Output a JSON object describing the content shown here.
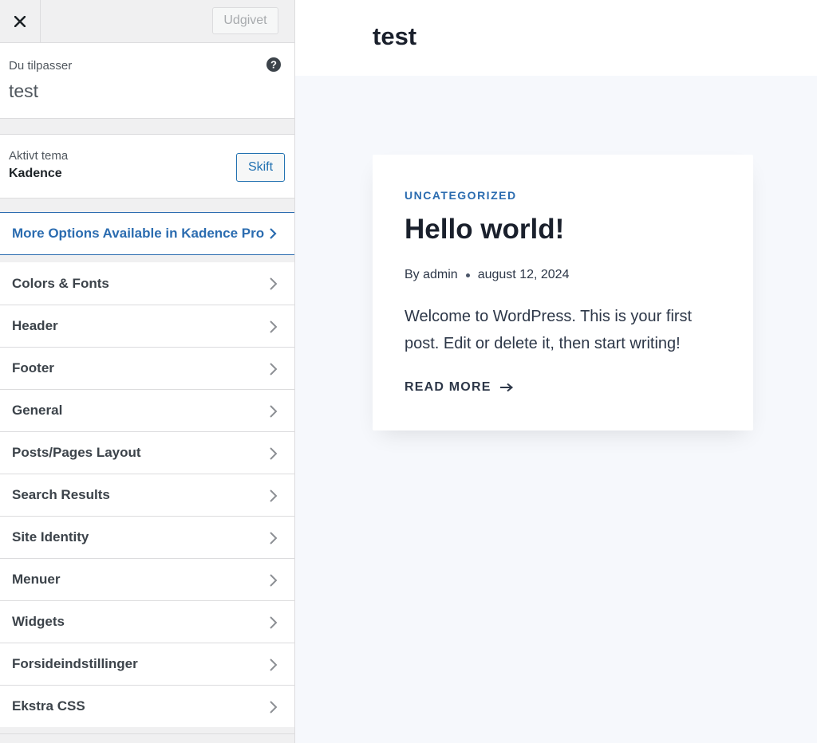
{
  "sidebar": {
    "publish_label": "Udgivet",
    "info": {
      "label": "Du tilpasser",
      "title": "test"
    },
    "theme": {
      "label": "Aktivt tema",
      "name": "Kadence",
      "change_label": "Skift"
    },
    "pro_link": "More Options Available in Kadence Pro",
    "sections": [
      {
        "label": "Colors & Fonts"
      },
      {
        "label": "Header"
      },
      {
        "label": "Footer"
      },
      {
        "label": "General"
      },
      {
        "label": "Posts/Pages Layout"
      },
      {
        "label": "Search Results"
      },
      {
        "label": "Site Identity"
      },
      {
        "label": "Menuer"
      },
      {
        "label": "Widgets"
      },
      {
        "label": "Forsideindstillinger"
      },
      {
        "label": "Ekstra CSS"
      }
    ]
  },
  "preview": {
    "site_title": "test",
    "post": {
      "category": "UNCATEGORIZED",
      "title": "Hello world!",
      "author": "By admin",
      "date": "august 12, 2024",
      "excerpt": "Welcome to WordPress. This is your first post. Edit or delete it, then start writing!",
      "read_more": "READ MORE"
    }
  },
  "colors": {
    "accent": "#2b6cb0",
    "sidebar_bg": "#f0f0f1",
    "preview_bg": "#f6f8fc"
  },
  "icons": {
    "close": "close-icon",
    "help": "help-icon",
    "chevron": "chevron-right-icon",
    "arrow": "arrow-right-icon"
  }
}
